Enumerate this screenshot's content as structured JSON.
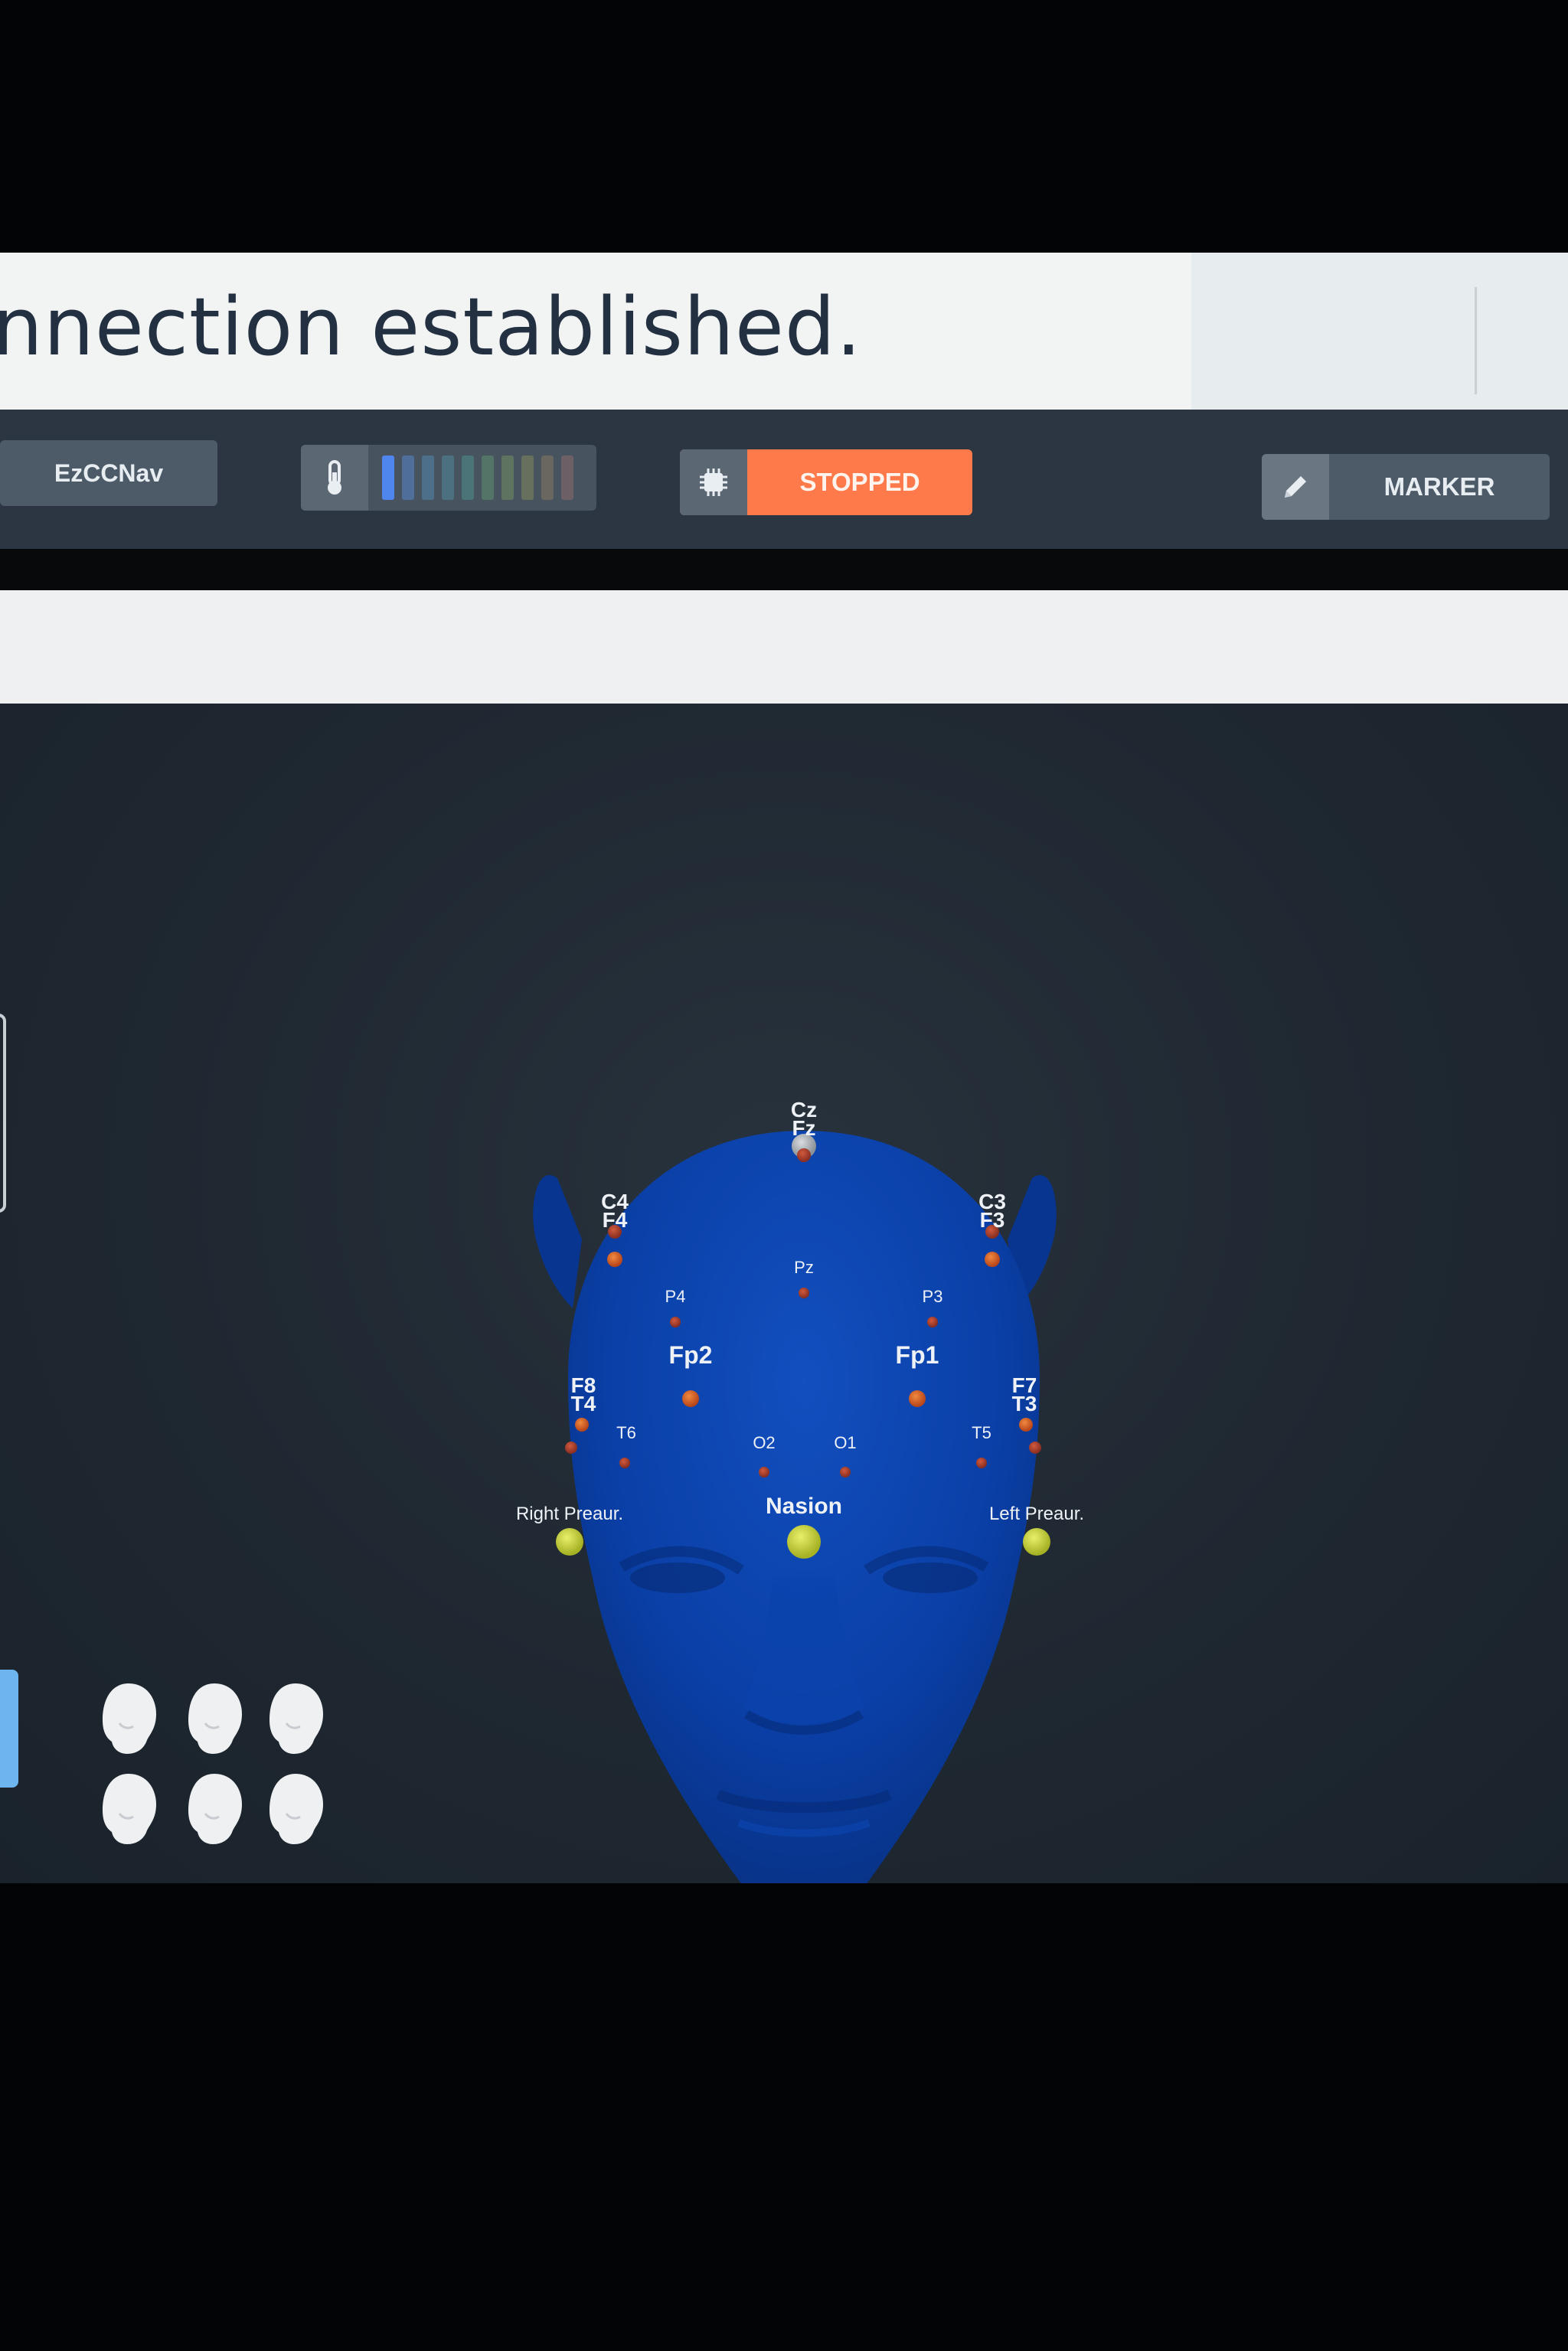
{
  "banner": {
    "message": "nnection established."
  },
  "toolbar": {
    "app_name": "EzCCNav",
    "battery_icon": "thermometer-icon",
    "level_bar_colors": [
      "#4f86ee",
      "#4f6f9a",
      "#4d6f8a",
      "#4d7080",
      "#4a7478",
      "#537466",
      "#5e7360",
      "#67705c",
      "#6a6660",
      "#6c5f66"
    ],
    "status_icon": "chip-icon",
    "status_label": "STOPPED",
    "status_color": "#ff7a4a",
    "marker_icon": "pencil-icon",
    "marker_label": "MARKER"
  },
  "viewport": {
    "model": "head-3d",
    "head_color": "#0a3d9e",
    "electrodes": [
      {
        "label": "Cz",
        "label2": "Fz",
        "kind": "reference"
      },
      {
        "label": "C4",
        "label2": "F4"
      },
      {
        "label": "C3",
        "label2": "F3"
      },
      {
        "label": "Pz"
      },
      {
        "label": "P4"
      },
      {
        "label": "P3"
      },
      {
        "label": "Fp2"
      },
      {
        "label": "Fp1"
      },
      {
        "label": "F8",
        "label2": "T4"
      },
      {
        "label": "F7",
        "label2": "T3"
      },
      {
        "label": "T6"
      },
      {
        "label": "T5"
      },
      {
        "label": "O2"
      },
      {
        "label": "O1"
      },
      {
        "label": "Nasion",
        "kind": "fiducial"
      },
      {
        "label": "Right Preaur.",
        "kind": "fiducial"
      },
      {
        "label": "Left Preaur.",
        "kind": "fiducial"
      }
    ],
    "view_buttons": [
      "view-left-front",
      "view-back",
      "view-right-front",
      "view-left",
      "view-top",
      "view-right"
    ]
  }
}
